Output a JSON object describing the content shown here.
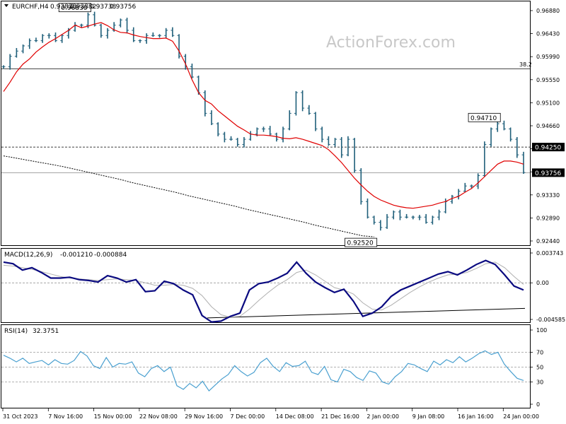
{
  "chart_data": {
    "type": "line",
    "symbol": "EURCHF,H4",
    "ohlc": [
      "0.93823",
      "0.93882",
      "0.93738",
      "0.93756"
    ],
    "watermark": "ActionForex.com",
    "colors": {
      "price": "#1f5f7a",
      "ma55": "#e00000",
      "ma_long": "#000000",
      "macd": "#0a0a80",
      "signal": "#b0b0b0",
      "rsi": "#4aa0d0"
    },
    "x_tick_labels": [
      "31 Oct 2023",
      "7 Nov 16:00",
      "15 Nov 00:00",
      "22 Nov 08:00",
      "29 Nov 16:00",
      "7 Dec 00:00",
      "14 Dec 08:00",
      "21 Dec 16:00",
      "2 Jan 00:00",
      "9 Jan 08:00",
      "16 Jan 16:00",
      "24 Jan 00:00"
    ],
    "price": {
      "ylim": [
        0.9244,
        0.9688
      ],
      "y_ticks": [
        "0.96880",
        "0.96430",
        "0.95990",
        "0.95550",
        "0.95100",
        "0.94660",
        "0.94210",
        "0.93770",
        "0.93330",
        "0.92890",
        "0.92440"
      ],
      "close": [
        0.958,
        0.96,
        0.961,
        0.962,
        0.963,
        0.963,
        0.964,
        0.964,
        0.963,
        0.964,
        0.965,
        0.966,
        0.966,
        0.968,
        0.966,
        0.964,
        0.965,
        0.966,
        0.967,
        0.965,
        0.963,
        0.963,
        0.964,
        0.964,
        0.964,
        0.965,
        0.964,
        0.96,
        0.958,
        0.956,
        0.953,
        0.949,
        0.947,
        0.945,
        0.944,
        0.944,
        0.943,
        0.944,
        0.945,
        0.946,
        0.946,
        0.945,
        0.944,
        0.946,
        0.949,
        0.953,
        0.95,
        0.949,
        0.946,
        0.944,
        0.943,
        0.944,
        0.941,
        0.944,
        0.938,
        0.932,
        0.929,
        0.928,
        0.927,
        0.929,
        0.93,
        0.929,
        0.929,
        0.929,
        0.929,
        0.928,
        0.929,
        0.93,
        0.932,
        0.933,
        0.934,
        0.935,
        0.935,
        0.937,
        0.943,
        0.946,
        0.947,
        0.946,
        0.944,
        0.941,
        0.9376
      ],
      "ma55": [
        0.9532,
        0.955,
        0.957,
        0.9585,
        0.9595,
        0.9608,
        0.9618,
        0.9627,
        0.9634,
        0.9642,
        0.965,
        0.966,
        0.9655,
        0.9658,
        0.9662,
        0.9665,
        0.9659,
        0.9651,
        0.9646,
        0.9645,
        0.9641,
        0.9638,
        0.9636,
        0.9634,
        0.9634,
        0.9635,
        0.9629,
        0.961,
        0.9585,
        0.9555,
        0.953,
        0.9515,
        0.9508,
        0.9495,
        0.9485,
        0.9475,
        0.9465,
        0.9458,
        0.945,
        0.9448,
        0.9448,
        0.9447,
        0.9445,
        0.9442,
        0.9441,
        0.9443,
        0.944,
        0.9436,
        0.9432,
        0.9428,
        0.942,
        0.9408,
        0.9395,
        0.938,
        0.9365,
        0.9352,
        0.934,
        0.933,
        0.9323,
        0.9318,
        0.9313,
        0.931,
        0.9308,
        0.9307,
        0.9309,
        0.9311,
        0.9313,
        0.9317,
        0.932,
        0.9326,
        0.933,
        0.9338,
        0.9345,
        0.9356,
        0.9368,
        0.938,
        0.9392,
        0.9398,
        0.9398,
        0.9396,
        0.9392
      ],
      "ma_long": [
        0.9408,
        0.9404,
        0.94,
        0.9396,
        0.9392,
        0.9388,
        0.9383,
        0.9378,
        0.9373,
        0.9368,
        0.9363,
        0.9357,
        0.9352,
        0.9347,
        0.9342,
        0.9337,
        0.9331,
        0.9326,
        0.9321,
        0.9316,
        0.9311,
        0.9305,
        0.93,
        0.9295,
        0.929,
        0.9285,
        0.928,
        0.9274,
        0.9269,
        0.9264,
        0.9259,
        0.9254,
        0.9252
      ],
      "fib": {
        "label": "38.2",
        "value": 0.9576
      },
      "hline_dashed": 0.9425,
      "hline_last": 0.93756,
      "annotations": [
        {
          "text": "0.96830",
          "x_index": 13,
          "y": 0.9683,
          "anchor": "above"
        },
        {
          "text": "0.92520",
          "x_index": 57,
          "y": 0.9252,
          "anchor": "below"
        },
        {
          "text": "0.94710",
          "x_index": 76,
          "y": 0.9471,
          "anchor": "above"
        }
      ],
      "tags": [
        {
          "text": "0.94250",
          "value": 0.9425
        },
        {
          "text": "0.93756",
          "value": 0.93756
        }
      ]
    },
    "macd": {
      "label": "MACD(12,26,9)",
      "values": [
        "-0.001210",
        "-0.000884"
      ],
      "ylim": [
        -0.004585,
        0.003743
      ],
      "y_ticks": [
        "0.003743",
        "0.00",
        "-0.004585"
      ],
      "macd": [
        0.0026,
        0.0024,
        0.0016,
        0.0019,
        0.0013,
        0.0006,
        0.0006,
        0.0007,
        0.0004,
        0.0003,
        0.0001,
        0.0009,
        0.0006,
        0.0001,
        0.0004,
        -0.0011,
        -0.001,
        0.0002,
        -0.0001,
        -0.0009,
        -0.0015,
        -0.0041,
        -0.0049,
        -0.0048,
        -0.0042,
        -0.0038,
        -0.0009,
        -0.0001,
        0.0001,
        0.0006,
        0.0012,
        0.0026,
        0.0012,
        0.0001,
        -0.0006,
        -0.0012,
        -0.0008,
        -0.0023,
        -0.0042,
        -0.0038,
        -0.003,
        -0.0017,
        -0.0009,
        -0.0004,
        0.0001,
        0.0006,
        0.0011,
        0.0014,
        0.001,
        0.0016,
        0.0023,
        0.0028,
        0.0023,
        0.001,
        -0.0004,
        -0.0009
      ],
      "signal": [
        0.0022,
        0.0021,
        0.0019,
        0.0017,
        0.0014,
        0.0011,
        0.0008,
        0.0006,
        0.0005,
        0.0004,
        0.0003,
        0.0004,
        0.0005,
        0.0004,
        0.0003,
        0.0,
        -0.0003,
        -0.0003,
        -0.0002,
        -0.0003,
        -0.0007,
        -0.0016,
        -0.003,
        -0.004,
        -0.0043,
        -0.0042,
        -0.0033,
        -0.0022,
        -0.0012,
        -0.0003,
        0.0004,
        0.0013,
        0.0016,
        0.001,
        0.0002,
        -0.0006,
        -0.0009,
        -0.0014,
        -0.0025,
        -0.0033,
        -0.0034,
        -0.0028,
        -0.002,
        -0.0012,
        -0.0005,
        0.0001,
        0.0006,
        0.001,
        0.0011,
        0.0013,
        0.0018,
        0.0024,
        0.0026,
        0.0019,
        0.0008,
        -0.0002
      ],
      "divergence_line": [
        [
          0.0,
          -0.0044
        ],
        [
          1.0,
          -0.0032
        ]
      ]
    },
    "rsi": {
      "label": "RSI(14)",
      "value": "32.3751",
      "ylim": [
        0,
        100
      ],
      "y_ticks": [
        "100",
        "70",
        "50",
        "30",
        "0"
      ],
      "levels": [
        70,
        50,
        30
      ],
      "values": [
        66,
        62,
        57,
        62,
        55,
        57,
        59,
        53,
        60,
        55,
        54,
        59,
        71,
        65,
        52,
        48,
        63,
        50,
        55,
        54,
        57,
        42,
        37,
        48,
        52,
        44,
        50,
        25,
        20,
        28,
        22,
        31,
        18,
        26,
        34,
        40,
        52,
        44,
        38,
        43,
        56,
        62,
        51,
        44,
        56,
        51,
        52,
        58,
        43,
        40,
        51,
        33,
        30,
        47,
        44,
        36,
        32,
        45,
        42,
        30,
        27,
        37,
        44,
        55,
        53,
        48,
        44,
        58,
        53,
        60,
        56,
        64,
        57,
        62,
        68,
        72,
        67,
        70,
        54,
        44,
        35,
        32
      ]
    }
  }
}
